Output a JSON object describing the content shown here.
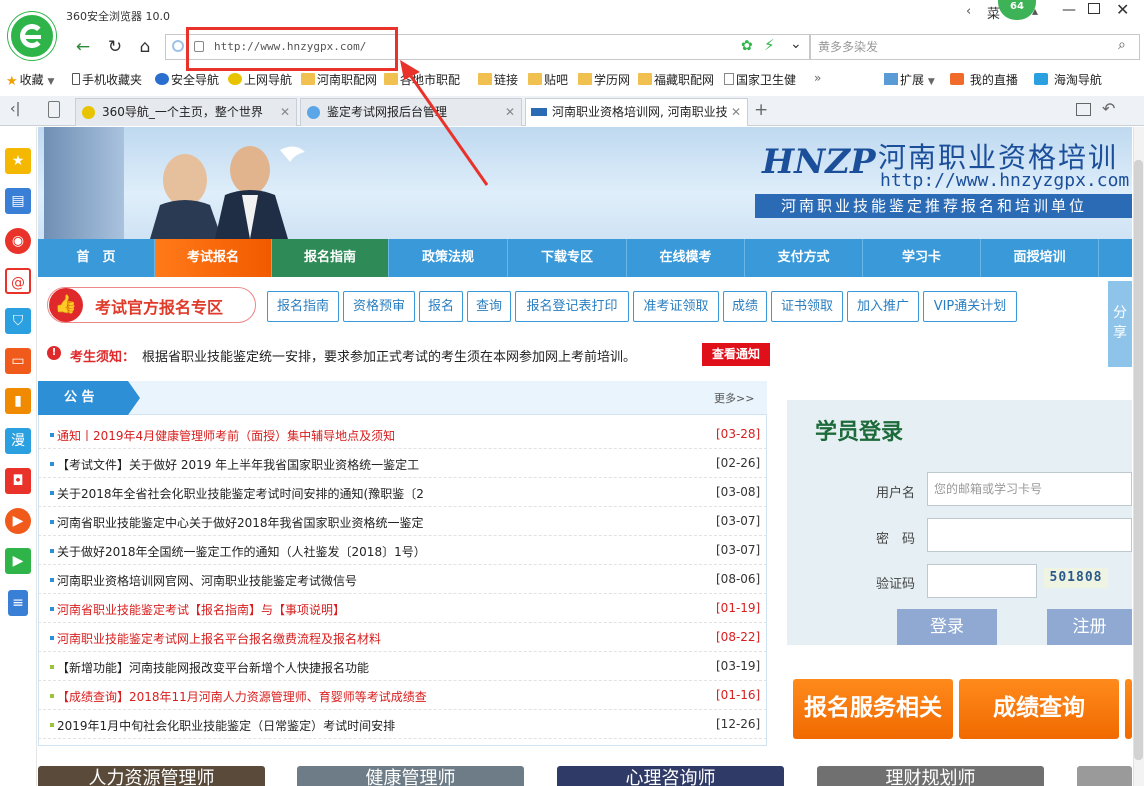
{
  "browser": {
    "title": "360安全浏览器 10.0",
    "url": "http://www.hnzygpx.com/",
    "search_placeholder": "黄多多染发",
    "badge": "64",
    "user_partial": "菜"
  },
  "bookmarks": [
    {
      "label": "收藏",
      "icon": "star-icon"
    },
    {
      "label": "手机收藏夹",
      "icon": "phone-icon"
    },
    {
      "label": "安全导航",
      "icon": "k-icon"
    },
    {
      "label": "上网导航",
      "icon": "nav-icon"
    },
    {
      "label": "河南职配网",
      "icon": "folder-icon"
    },
    {
      "label": "各地市职配",
      "icon": "folder-icon"
    },
    {
      "label": "链接",
      "icon": "folder-icon"
    },
    {
      "label": "贴吧",
      "icon": "folder-icon"
    },
    {
      "label": "学历网",
      "icon": "folder-icon"
    },
    {
      "label": "福藏职配网",
      "icon": "folder-icon"
    },
    {
      "label": "国家卫生健",
      "icon": "page-icon"
    },
    {
      "label": "扩展",
      "icon": "grid-icon"
    },
    {
      "label": "我的直播",
      "icon": "tv-icon"
    },
    {
      "label": "海淘导航",
      "icon": "globe-icon"
    }
  ],
  "tabs": [
    {
      "label": "360导航_一个主页，整个世界"
    },
    {
      "label": "鉴定考试网报后台管理"
    },
    {
      "label": "河南职业资格培训网, 河南职业技"
    }
  ],
  "site": {
    "logo": "HNZP",
    "name": "河南职业资格培训",
    "url": "http://www.hnzyzgpx.com",
    "subtitle": "河南职业技能鉴定推荐报名和培训单位"
  },
  "main_nav": [
    "首　页",
    "考试报名",
    "报名指南",
    "政策法规",
    "下载专区",
    "在线模考",
    "支付方式",
    "学习卡",
    "面授培训"
  ],
  "exam": {
    "title": "考试官方报名专区",
    "buttons": [
      "报名指南",
      "资格预审",
      "报名",
      "查询",
      "报名登记表打印",
      "准考证领取",
      "成绩",
      "证书领取",
      "加入推广",
      "VIP通关计划"
    ]
  },
  "share_label": "分享",
  "notice": {
    "label": "考生须知：",
    "text": "根据省职业技能鉴定统一安排，要求参加正式考试的考生须在本网参加网上考前培训。",
    "button": "查看通知"
  },
  "announcements": {
    "title": "公 告",
    "more": "更多>>",
    "items": [
      {
        "text": "通知丨2019年4月健康管理师考前（面授）集中辅导地点及须知",
        "date": "[03-28]",
        "color": "#d81e1e",
        "dot": "#2d8fd6"
      },
      {
        "text": "【考试文件】关于做好 2019 年上半年我省国家职业资格统一鉴定工",
        "date": "[02-26]",
        "color": "#222222",
        "dot": "#2d8fd6"
      },
      {
        "text": "关于2018年全省社会化职业技能鉴定考试时间安排的通知(豫职鉴〔2",
        "date": "[03-08]",
        "color": "#222222",
        "dot": "#2d8fd6"
      },
      {
        "text": "河南省职业技能鉴定中心关于做好2018年我省国家职业资格统一鉴定",
        "date": "[03-07]",
        "color": "#222222",
        "dot": "#2d8fd6"
      },
      {
        "text": "关于做好2018年全国统一鉴定工作的通知（人社鉴发〔2018〕1号）",
        "date": "[03-07]",
        "color": "#222222",
        "dot": "#2d8fd6"
      },
      {
        "text": "河南职业资格培训网官网、河南职业技能鉴定考试微信号",
        "date": "[08-06]",
        "color": "#222222",
        "dot": "#2d8fd6"
      },
      {
        "text": "河南省职业技能鉴定考试【报名指南】与【事项说明】",
        "date": "[01-19]",
        "color": "#d81e1e",
        "dot": "#2d8fd6"
      },
      {
        "text": "河南职业技能鉴定考试网上报名平台报名缴费流程及报名材料",
        "date": "[08-22]",
        "color": "#d81e1e",
        "dot": "#2d8fd6"
      },
      {
        "text": "【新增功能】河南技能网报改变平台新增个人快捷报名功能",
        "date": "[03-19]",
        "color": "#222222",
        "dot": "#9bc43c"
      },
      {
        "text": "【成绩查询】2018年11月河南人力资源管理师、育婴师等考试成绩查",
        "date": "[01-16]",
        "color": "#d81e1e",
        "dot": "#9bc43c"
      },
      {
        "text": "2019年1月中旬社会化职业技能鉴定（日常鉴定）考试时间安排",
        "date": "[12-26]",
        "color": "#222222",
        "dot": "#9bc43c"
      }
    ]
  },
  "login": {
    "title": "学员登录",
    "username_label": "用户名",
    "username_placeholder": "您的邮箱或学习卡号",
    "password_label": "密　码",
    "captcha_label": "验证码",
    "captcha": "501808",
    "login_button": "登录",
    "register_button": "注册"
  },
  "promo": [
    "报名服务相关",
    "成绩查询"
  ],
  "courses": [
    "人力资源管理师",
    "健康管理师",
    "心理咨询师",
    "理财规划师"
  ]
}
